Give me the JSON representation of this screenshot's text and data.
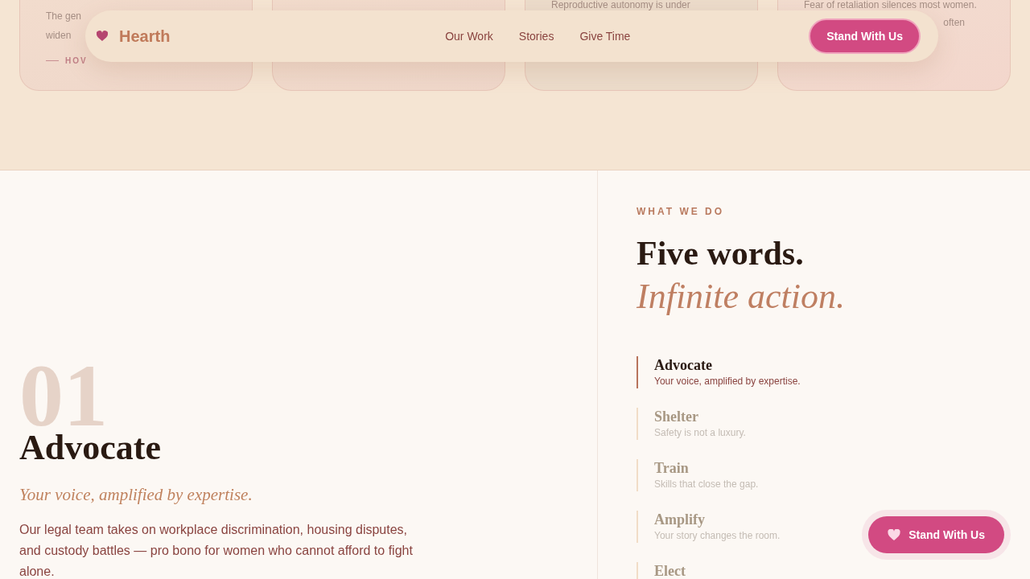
{
  "top_cards": [
    {
      "kind": "excerpt",
      "lines": [
        "The gen",
        "widen"
      ],
      "link": "HOV"
    },
    {
      "kind": "blank"
    },
    {
      "kind": "excerpt",
      "lines": [
        "Reproductive autonomy is under"
      ]
    },
    {
      "kind": "excerpt",
      "lines": [
        "Fear of retaliation silences most women.",
        "often"
      ]
    }
  ],
  "nav": {
    "brand": "Hearth",
    "links": [
      "Our Work",
      "Stories",
      "Give Time"
    ],
    "cta": "Stand With Us"
  },
  "feature": {
    "number": "01",
    "title": "Advocate",
    "tagline": "Your voice, amplified by expertise.",
    "body": "Our legal team takes on workplace discrimination, housing disputes, and custody battles — pro bono for women who cannot afford to fight alone."
  },
  "services": {
    "eyebrow": "WHAT WE DO",
    "heading": "Five words.",
    "heading_accent": "Infinite action.",
    "items": [
      {
        "title": "Advocate",
        "subtitle": "Your voice, amplified by expertise.",
        "selected": true
      },
      {
        "title": "Shelter",
        "subtitle": "Safety is not a luxury.",
        "selected": false
      },
      {
        "title": "Train",
        "subtitle": "Skills that close the gap.",
        "selected": false
      },
      {
        "title": "Amplify",
        "subtitle": "Your story changes the room.",
        "selected": false
      },
      {
        "title": "Elect",
        "selected": false
      }
    ]
  },
  "floating_button": {
    "label": "Stand With Us"
  }
}
